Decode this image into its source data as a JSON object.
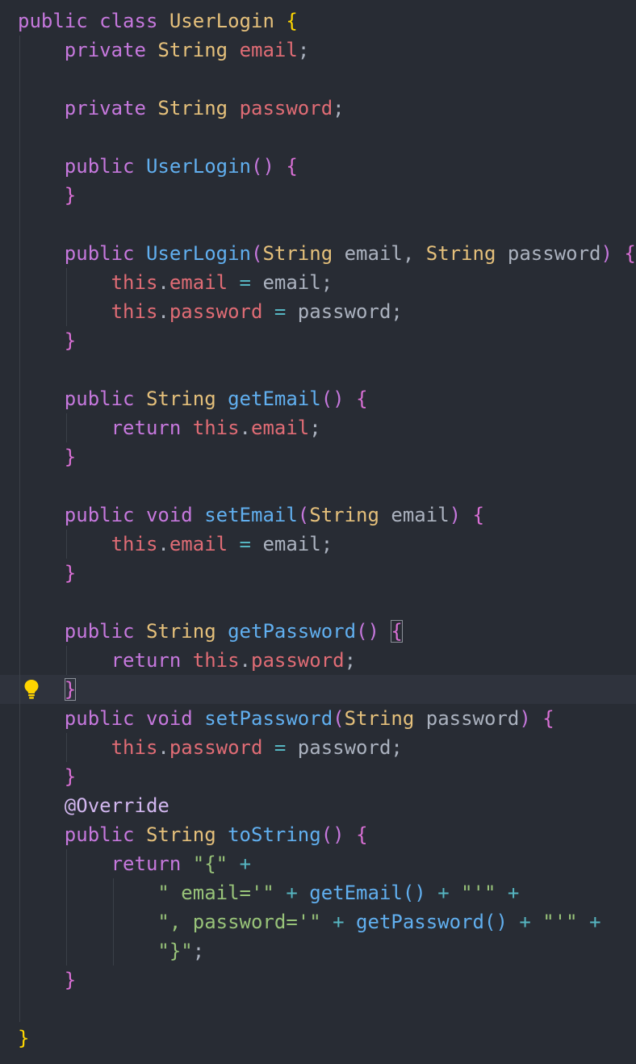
{
  "editor": {
    "theme": "one-dark",
    "active_line_index": 23,
    "gutter_icon": "lightbulb-icon",
    "colors": {
      "background": "#282c34",
      "active_line": "#2f333d",
      "keyword": "#c678dd",
      "type": "#e5c07b",
      "field": "#e06c75",
      "function": "#61afef",
      "string": "#98c379",
      "operator": "#56b6c2",
      "plain": "#abb2bf",
      "brace_level_1": "#ffd700",
      "brace_level_2": "#da70d6"
    },
    "lines": [
      [
        [
          "kw",
          "public"
        ],
        [
          "plain",
          " "
        ],
        [
          "kw",
          "class"
        ],
        [
          "plain",
          " "
        ],
        [
          "type",
          "UserLogin"
        ],
        [
          "plain",
          " "
        ],
        [
          "brace",
          "{"
        ]
      ],
      [
        [
          "plain",
          "    "
        ],
        [
          "kw",
          "private"
        ],
        [
          "plain",
          " "
        ],
        [
          "type",
          "String"
        ],
        [
          "plain",
          " "
        ],
        [
          "field",
          "email"
        ],
        [
          "plain",
          ";"
        ]
      ],
      [],
      [
        [
          "plain",
          "    "
        ],
        [
          "kw",
          "private"
        ],
        [
          "plain",
          " "
        ],
        [
          "type",
          "String"
        ],
        [
          "plain",
          " "
        ],
        [
          "field",
          "password"
        ],
        [
          "plain",
          ";"
        ]
      ],
      [],
      [
        [
          "plain",
          "    "
        ],
        [
          "kw",
          "public"
        ],
        [
          "plain",
          " "
        ],
        [
          "fn",
          "UserLogin"
        ],
        [
          "paren",
          "()"
        ],
        [
          "plain",
          " "
        ],
        [
          "bracep",
          "{"
        ]
      ],
      [
        [
          "plain",
          "    "
        ],
        [
          "bracep",
          "}"
        ]
      ],
      [],
      [
        [
          "plain",
          "    "
        ],
        [
          "kw",
          "public"
        ],
        [
          "plain",
          " "
        ],
        [
          "fn",
          "UserLogin"
        ],
        [
          "paren",
          "("
        ],
        [
          "type",
          "String"
        ],
        [
          "plain",
          " email, "
        ],
        [
          "type",
          "String"
        ],
        [
          "plain",
          " password"
        ],
        [
          "paren",
          ")"
        ],
        [
          "plain",
          " "
        ],
        [
          "bracep",
          "{"
        ]
      ],
      [
        [
          "plain",
          "        "
        ],
        [
          "field",
          "this"
        ],
        [
          "plain",
          "."
        ],
        [
          "field",
          "email"
        ],
        [
          "plain",
          " "
        ],
        [
          "op",
          "="
        ],
        [
          "plain",
          " email;"
        ]
      ],
      [
        [
          "plain",
          "        "
        ],
        [
          "field",
          "this"
        ],
        [
          "plain",
          "."
        ],
        [
          "field",
          "password"
        ],
        [
          "plain",
          " "
        ],
        [
          "op",
          "="
        ],
        [
          "plain",
          " password;"
        ]
      ],
      [
        [
          "plain",
          "    "
        ],
        [
          "bracep",
          "}"
        ]
      ],
      [],
      [
        [
          "plain",
          "    "
        ],
        [
          "kw",
          "public"
        ],
        [
          "plain",
          " "
        ],
        [
          "type",
          "String"
        ],
        [
          "plain",
          " "
        ],
        [
          "fn",
          "getEmail"
        ],
        [
          "paren",
          "()"
        ],
        [
          "plain",
          " "
        ],
        [
          "bracep",
          "{"
        ]
      ],
      [
        [
          "plain",
          "        "
        ],
        [
          "kw",
          "return"
        ],
        [
          "plain",
          " "
        ],
        [
          "field",
          "this"
        ],
        [
          "plain",
          "."
        ],
        [
          "field",
          "email"
        ],
        [
          "plain",
          ";"
        ]
      ],
      [
        [
          "plain",
          "    "
        ],
        [
          "bracep",
          "}"
        ]
      ],
      [],
      [
        [
          "plain",
          "    "
        ],
        [
          "kw",
          "public"
        ],
        [
          "plain",
          " "
        ],
        [
          "kw",
          "void"
        ],
        [
          "plain",
          " "
        ],
        [
          "fn",
          "setEmail"
        ],
        [
          "paren",
          "("
        ],
        [
          "type",
          "String"
        ],
        [
          "plain",
          " email"
        ],
        [
          "paren",
          ")"
        ],
        [
          "plain",
          " "
        ],
        [
          "bracep",
          "{"
        ]
      ],
      [
        [
          "plain",
          "        "
        ],
        [
          "field",
          "this"
        ],
        [
          "plain",
          "."
        ],
        [
          "field",
          "email"
        ],
        [
          "plain",
          " "
        ],
        [
          "op",
          "="
        ],
        [
          "plain",
          " email;"
        ]
      ],
      [
        [
          "plain",
          "    "
        ],
        [
          "bracep",
          "}"
        ]
      ],
      [],
      [
        [
          "plain",
          "    "
        ],
        [
          "kw",
          "public"
        ],
        [
          "plain",
          " "
        ],
        [
          "type",
          "String"
        ],
        [
          "plain",
          " "
        ],
        [
          "fn",
          "getPassword"
        ],
        [
          "paren",
          "()"
        ],
        [
          "plain",
          " "
        ],
        [
          "bracep",
          "{",
          "bm"
        ]
      ],
      [
        [
          "plain",
          "        "
        ],
        [
          "kw",
          "return"
        ],
        [
          "plain",
          " "
        ],
        [
          "field",
          "this"
        ],
        [
          "plain",
          "."
        ],
        [
          "field",
          "password"
        ],
        [
          "plain",
          ";"
        ]
      ],
      [
        [
          "plain",
          "    "
        ],
        [
          "bracep",
          "}",
          "bm"
        ]
      ],
      [
        [
          "plain",
          "    "
        ],
        [
          "kw",
          "public"
        ],
        [
          "plain",
          " "
        ],
        [
          "kw",
          "void"
        ],
        [
          "plain",
          " "
        ],
        [
          "fn",
          "setPassword"
        ],
        [
          "paren",
          "("
        ],
        [
          "type",
          "String"
        ],
        [
          "plain",
          " password"
        ],
        [
          "paren",
          ")"
        ],
        [
          "plain",
          " "
        ],
        [
          "bracep",
          "{"
        ]
      ],
      [
        [
          "plain",
          "        "
        ],
        [
          "field",
          "this"
        ],
        [
          "plain",
          "."
        ],
        [
          "field",
          "password"
        ],
        [
          "plain",
          " "
        ],
        [
          "op",
          "="
        ],
        [
          "plain",
          " password;"
        ]
      ],
      [
        [
          "plain",
          "    "
        ],
        [
          "bracep",
          "}"
        ]
      ],
      [
        [
          "plain",
          "    "
        ],
        [
          "ann",
          "@Override"
        ]
      ],
      [
        [
          "plain",
          "    "
        ],
        [
          "kw",
          "public"
        ],
        [
          "plain",
          " "
        ],
        [
          "type",
          "String"
        ],
        [
          "plain",
          " "
        ],
        [
          "fn",
          "toString"
        ],
        [
          "paren",
          "()"
        ],
        [
          "plain",
          " "
        ],
        [
          "bracep",
          "{"
        ]
      ],
      [
        [
          "plain",
          "        "
        ],
        [
          "kw",
          "return"
        ],
        [
          "plain",
          " "
        ],
        [
          "str",
          "\"{\""
        ],
        [
          "plain",
          " "
        ],
        [
          "op",
          "+"
        ]
      ],
      [
        [
          "plain",
          "            "
        ],
        [
          "str",
          "\" email='\""
        ],
        [
          "plain",
          " "
        ],
        [
          "op",
          "+"
        ],
        [
          "plain",
          " "
        ],
        [
          "fn",
          "getEmail"
        ],
        [
          "fn",
          "()"
        ],
        [
          "plain",
          " "
        ],
        [
          "op",
          "+"
        ],
        [
          "plain",
          " "
        ],
        [
          "str",
          "\"'\""
        ],
        [
          "plain",
          " "
        ],
        [
          "op",
          "+"
        ]
      ],
      [
        [
          "plain",
          "            "
        ],
        [
          "str",
          "\", password='\""
        ],
        [
          "plain",
          " "
        ],
        [
          "op",
          "+"
        ],
        [
          "plain",
          " "
        ],
        [
          "fn",
          "getPassword"
        ],
        [
          "fn",
          "()"
        ],
        [
          "plain",
          " "
        ],
        [
          "op",
          "+"
        ],
        [
          "plain",
          " "
        ],
        [
          "str",
          "\"'\""
        ],
        [
          "plain",
          " "
        ],
        [
          "op",
          "+"
        ]
      ],
      [
        [
          "plain",
          "            "
        ],
        [
          "str",
          "\"}\""
        ],
        [
          "plain",
          ";"
        ]
      ],
      [
        [
          "plain",
          "    "
        ],
        [
          "bracep",
          "}"
        ]
      ],
      [],
      [
        [
          "brace",
          "}"
        ]
      ]
    ]
  }
}
